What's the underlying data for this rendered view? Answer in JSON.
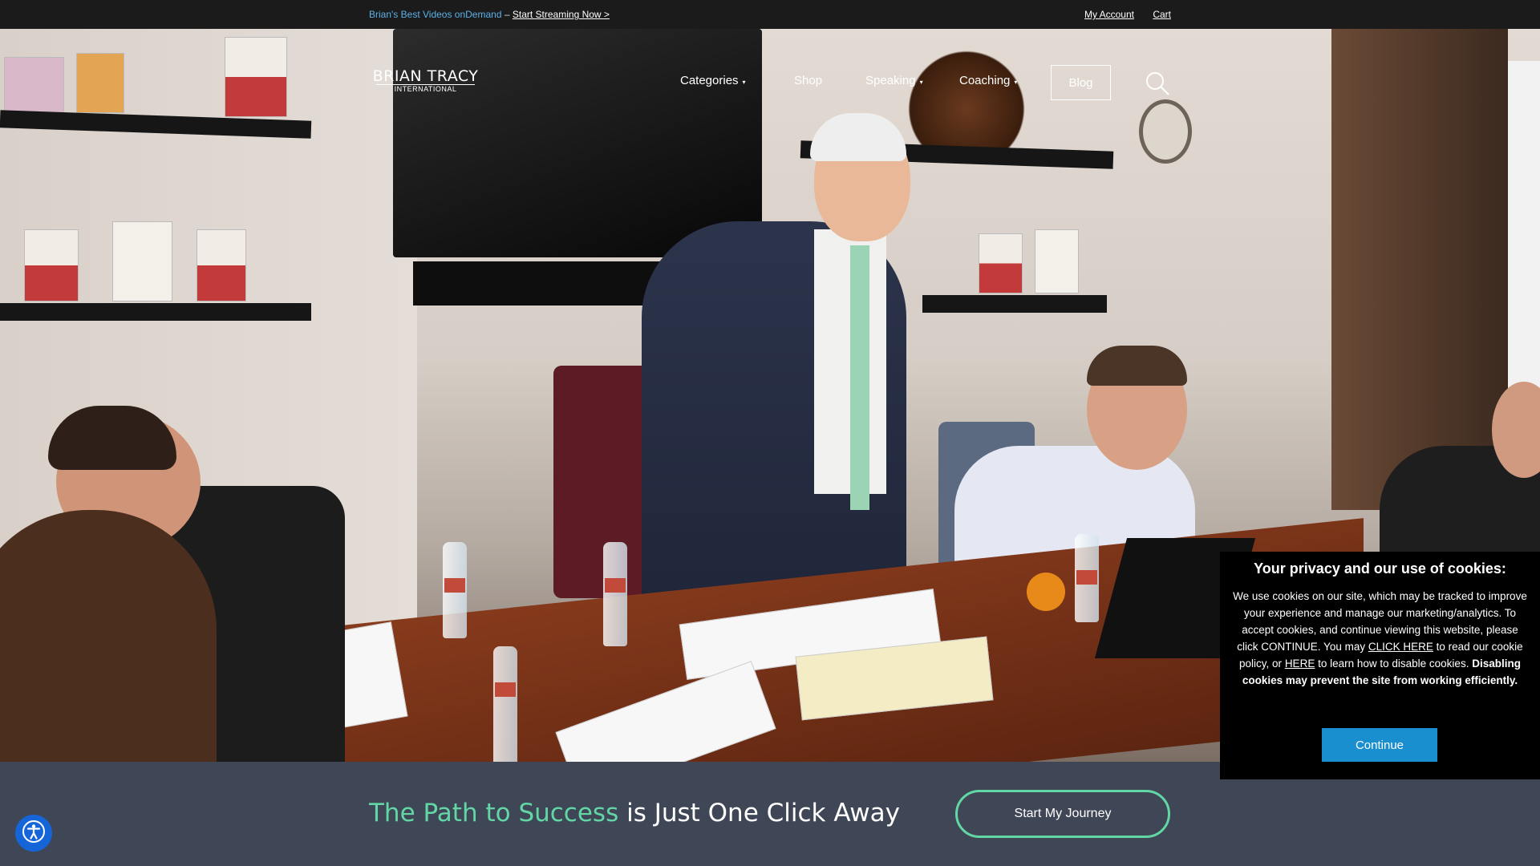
{
  "topbar": {
    "promo_highlight": "Brian's Best Videos onDemand",
    "promo_separator": "–",
    "promo_link": "Start Streaming Now >",
    "my_account": "My Account",
    "cart": "Cart"
  },
  "logo": {
    "line1": "BRIAN TRACY",
    "line2": "INTERNATIONAL"
  },
  "nav": {
    "items": [
      {
        "label": "Categories",
        "dropdown": true
      },
      {
        "label": "Shop",
        "dropdown": false
      },
      {
        "label": "Speaking",
        "dropdown": true
      },
      {
        "label": "Coaching",
        "dropdown": true
      }
    ],
    "caret": "▾",
    "blog": "Blog",
    "search_icon": "search-icon"
  },
  "band": {
    "headline_accent": "The Path to Success",
    "headline_rest": " is Just One Click Away",
    "button": "Start My Journey",
    "accent_color": "#62d7a5"
  },
  "cookie": {
    "title": "Your privacy and our use of cookies:",
    "body_1": "We use cookies on our site, which may be tracked to improve your experience and manage our marketing/analytics. To accept cookies, and continue viewing this website, please click CONTINUE. You may ",
    "link_1": "CLICK HERE",
    "body_2": " to read our cookie policy, or ",
    "link_2": "HERE",
    "body_3": " to learn how to disable cookies. ",
    "bold": "Disabling cookies may prevent the site from working efficiently.",
    "continue": "Continue",
    "button_color": "#1a8fd0"
  },
  "accessibility": {
    "icon": "accessibility-icon"
  }
}
